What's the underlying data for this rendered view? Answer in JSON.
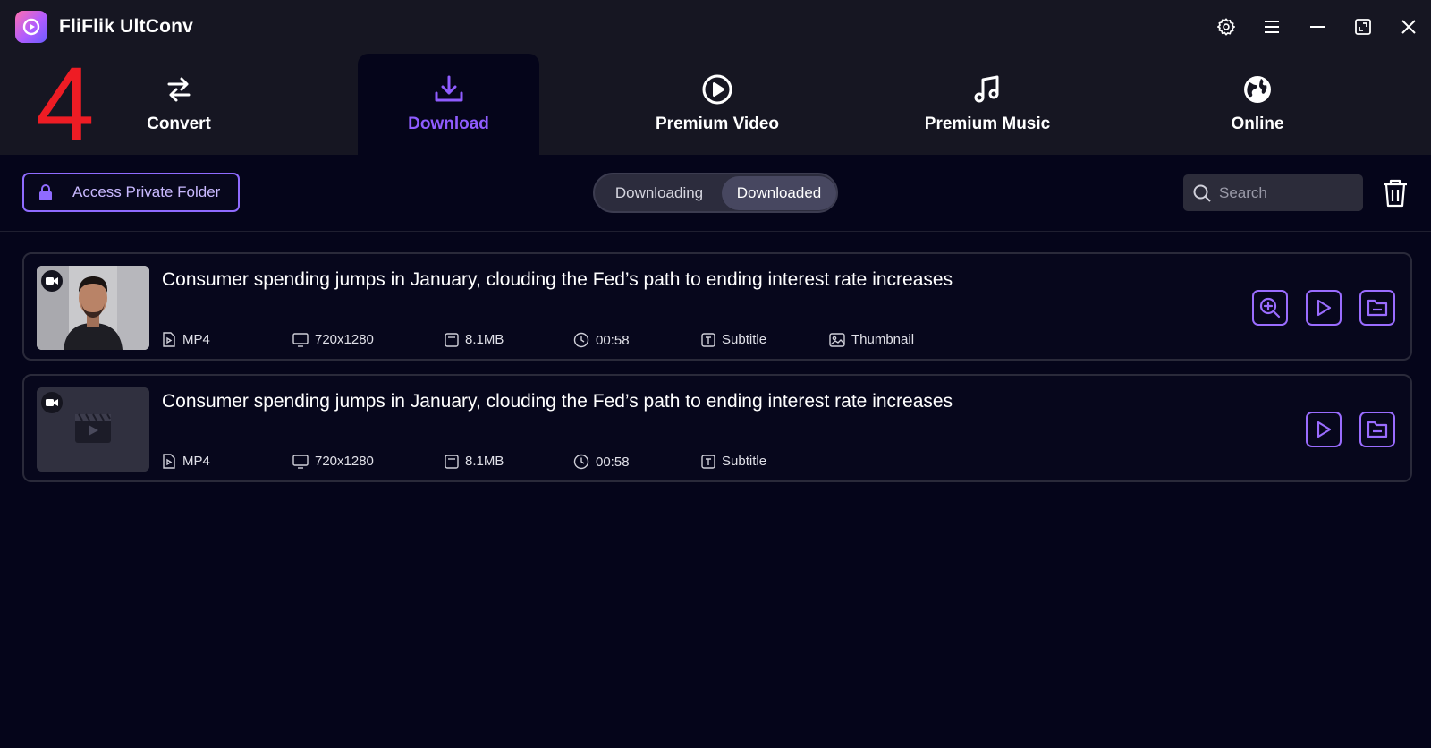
{
  "app": {
    "title": "FliFlik UltConv"
  },
  "step_marker": "4",
  "nav": {
    "tabs": [
      {
        "label": "Convert"
      },
      {
        "label": "Download"
      },
      {
        "label": "Premium Video"
      },
      {
        "label": "Premium Music"
      },
      {
        "label": "Online"
      }
    ],
    "active": "Download"
  },
  "toolbar": {
    "private_folder_label": "Access Private Folder",
    "segments": [
      "Downloading",
      "Downloaded"
    ],
    "active_segment": "Downloaded",
    "search_placeholder": "Search"
  },
  "items": [
    {
      "title": "Consumer spending jumps in January, clouding the Fed’s path to ending interest rate increases",
      "format": "MP4",
      "resolution": "720x1280",
      "size": "8.1MB",
      "duration": "00:58",
      "subtitle": "Subtitle",
      "thumbnail": "Thumbnail",
      "has_thumbnail_image": true,
      "actions": [
        "zoom-icon",
        "play-icon",
        "folder-icon"
      ]
    },
    {
      "title": "Consumer spending jumps in January, clouding the Fed’s path to ending interest rate increases",
      "format": "MP4",
      "resolution": "720x1280",
      "size": "8.1MB",
      "duration": "00:58",
      "subtitle": "Subtitle",
      "has_thumbnail_image": false,
      "actions": [
        "play-icon",
        "folder-icon"
      ]
    }
  ],
  "colors": {
    "accent": "#8f5cff",
    "background": "#05051a",
    "header": "#161622",
    "step_marker": "#ee1c24"
  }
}
